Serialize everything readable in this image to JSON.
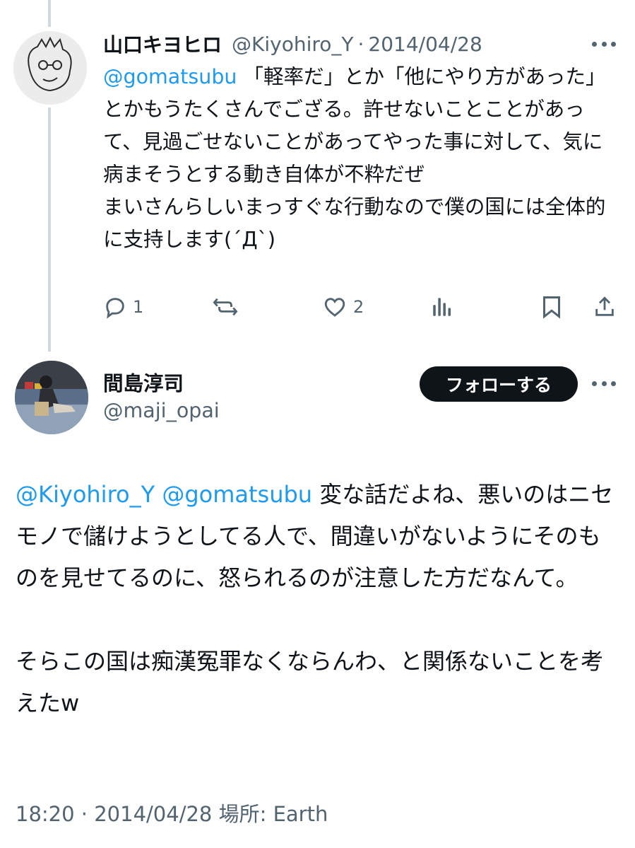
{
  "reply_tweet": {
    "display_name": "山口キヨヒロ",
    "handle": "@Kiyohiro_Y",
    "separator": "·",
    "date": "2014/04/28",
    "mention": "@gomatsubu",
    "text": " 「軽率だ」とか「他にやり方があった」とかもうたくさんでござる。許せないことことがあって、見過ごせないことがあってやった事に対して、気に病まそうとする動き自体が不粋だぜ\nまいさんらしいまっすぐな行動なので僕の国には全体的に支持します(´Д`)",
    "reply_count": "1",
    "like_count": "2",
    "icons": [
      "more-dots-icon",
      "reply-icon",
      "retweet-icon",
      "like-icon",
      "views-icon",
      "bookmark-icon",
      "share-icon"
    ]
  },
  "main_tweet": {
    "display_name": "間島淳司",
    "handle": "@maji_opai",
    "follow_label": "フォローする",
    "mentions": "@Kiyohiro_Y @gomatsubu",
    "text": " 変な話だよね、悪いのはニセモノで儲けようとしてる人で、間違いがないようにそのものを見せてるのに、怒られるのが注意した方だなんて。\n\nそらこの国は痴漢冤罪なくならんわ、と関係ないことを考えたw",
    "meta": "18:20 · 2014/04/28 場所: Earth"
  },
  "colors": {
    "text": "#0f1419",
    "muted": "#536471",
    "link": "#1d9bf0",
    "thread_line": "#cfd9de",
    "button_bg": "#0f1419"
  }
}
